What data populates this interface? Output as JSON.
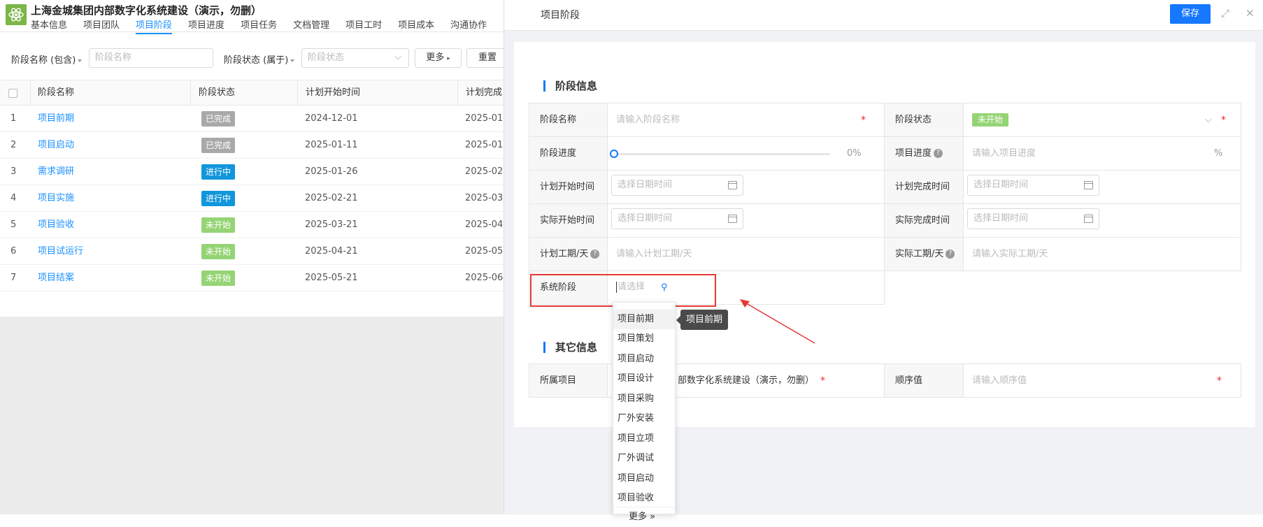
{
  "app": {
    "title": "上海金城集团内部数字化系统建设（演示，勿删）",
    "tabs": [
      "基本信息",
      "项目团队",
      "项目阶段",
      "项目进度",
      "项目任务",
      "文档管理",
      "项目工时",
      "项目成本",
      "沟通协作"
    ],
    "active_tab": "项目阶段"
  },
  "filters": {
    "name_label": "阶段名称 (包含)",
    "name_placeholder": "阶段名称",
    "status_label": "阶段状态 (属于)",
    "status_placeholder": "阶段状态",
    "more_label": "更多",
    "reset_label": "重置"
  },
  "table": {
    "headers": [
      "阶段名称",
      "阶段状态",
      "计划开始时间",
      "计划完成"
    ],
    "rows": [
      {
        "index": "1",
        "name": "项目前期",
        "status": "已完成",
        "start": "2024-12-01",
        "end": "2025-01-"
      },
      {
        "index": "2",
        "name": "项目启动",
        "status": "已完成",
        "start": "2025-01-11",
        "end": "2025-01-"
      },
      {
        "index": "3",
        "name": "需求调研",
        "status": "进行中",
        "start": "2025-01-26",
        "end": "2025-02-"
      },
      {
        "index": "4",
        "name": "项目实施",
        "status": "进行中",
        "start": "2025-02-21",
        "end": "2025-03-"
      },
      {
        "index": "5",
        "name": "项目验收",
        "status": "未开始",
        "start": "2025-03-21",
        "end": "2025-04-"
      },
      {
        "index": "6",
        "name": "项目试运行",
        "status": "未开始",
        "start": "2025-04-21",
        "end": "2025-05-"
      },
      {
        "index": "7",
        "name": "项目结案",
        "status": "未开始",
        "start": "2025-05-21",
        "end": "2025-06-"
      }
    ],
    "status_colors": {
      "已完成": "#a9a9a9",
      "进行中": "#1296db",
      "未开始": "#95d475"
    }
  },
  "panel": {
    "title": "项目阶段",
    "save_label": "保存",
    "section_stage": "阶段信息",
    "section_other": "其它信息",
    "fields": {
      "stage_name_label": "阶段名称",
      "stage_name_placeholder": "请输入阶段名称",
      "stage_status_label": "阶段状态",
      "stage_status_value": "未开始",
      "stage_progress_label": "阶段进度",
      "stage_progress_value": "0%",
      "stage_progress_fraction": 0,
      "project_progress_label": "项目进度",
      "project_progress_placeholder": "请输入项目进度",
      "project_progress_unit": "%",
      "plan_start_label": "计划开始时间",
      "plan_end_label": "计划完成时间",
      "actual_start_label": "实际开始时间",
      "actual_end_label": "实际完成时间",
      "date_placeholder": "选择日期时间",
      "plan_days_label": "计划工期/天",
      "plan_days_placeholder": "请输入计划工期/天",
      "actual_days_label": "实际工期/天",
      "actual_days_placeholder": "请输入实际工期/天",
      "system_stage_label": "系统阶段",
      "system_stage_placeholder": "请选择",
      "project_label": "所属项目",
      "project_value": "部数字化系统建设（演示，勿删）",
      "order_label": "顺序值",
      "order_placeholder": "请输入顺序值",
      "required_mark": "*",
      "help_mark": "?"
    },
    "dropdown_options": [
      "项目前期",
      "项目策划",
      "项目启动",
      "项目设计",
      "项目采购",
      "厂外安装",
      "项目立项",
      "厂外调试",
      "项目启动",
      "项目验收"
    ],
    "dropdown_more": "更多 »",
    "tooltip": "项目前期"
  }
}
